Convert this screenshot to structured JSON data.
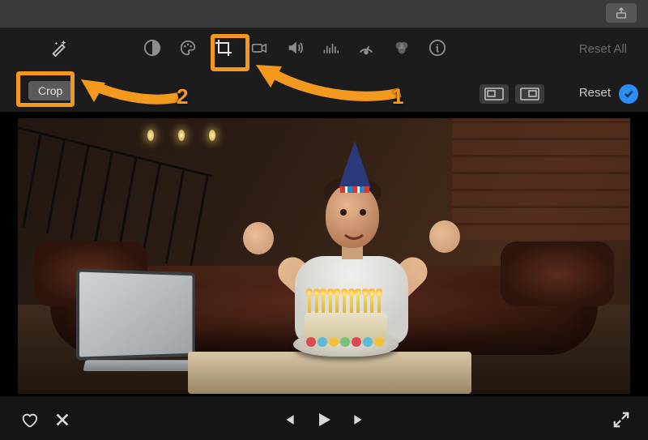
{
  "titlebar": {
    "share_icon": "share-icon"
  },
  "toolbar": {
    "wand_icon": "magic-wand-icon",
    "icons": [
      "contrast-icon",
      "color-palette-icon",
      "crop-icon",
      "camera-icon",
      "volume-icon",
      "equalizer-icon",
      "speed-dial-icon",
      "color-balance-icon",
      "info-icon"
    ],
    "reset_all_label": "Reset All"
  },
  "subbar": {
    "crop_label": "Crop",
    "kenburns_start_icon": "kenburns-start-icon",
    "kenburns_end_icon": "kenburns-end-icon",
    "reset_label": "Reset",
    "confirm_icon": "checkmark-icon"
  },
  "annotations": {
    "crop_tool_highlight": "highlight-crop-toolbar",
    "crop_pill_highlight": "highlight-crop-pill",
    "label_1": "1",
    "label_2": "2"
  },
  "preview": {
    "description": "Man in party hat on leather couch behind birthday cake with lit candles, laptop in foreground"
  },
  "playback": {
    "favorite_icon": "heart-icon",
    "reject_icon": "x-icon",
    "prev_icon": "skip-back-icon",
    "play_icon": "play-icon",
    "next_icon": "skip-forward-icon",
    "expand_icon": "expand-icon"
  }
}
